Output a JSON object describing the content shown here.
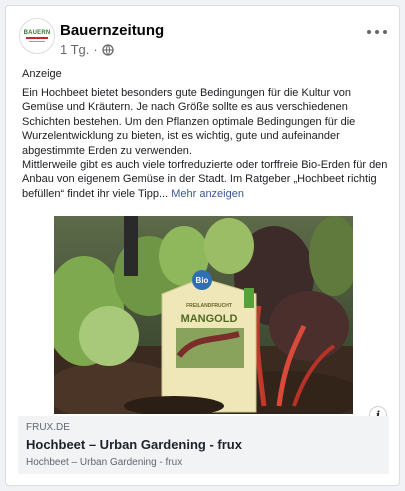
{
  "post": {
    "page_name": "Bauernzeitung",
    "avatar_logo_text": "BAUERN",
    "time": "1 Tg.",
    "separator": "·",
    "visibility_icon": "globe-icon",
    "more_icon": "more-horizontal-icon",
    "ad_label": "Anzeige",
    "paragraph_1": "Ein Hochbeet bietet besonders gute Bedingungen für die Kultur von Gemüse und Kräutern. Je nach Größe sollte es aus verschiedenen Schichten bestehen. Um den Pflanzen optimale Bedingungen für die Wurzelentwicklung zu bieten, ist es wichtig, gute und aufeinander abgestimmte Erden zu verwenden.",
    "paragraph_2": "Mittlerweile gibt es auch viele torfreduzierte oder torffreie Bio-Erden für den Anbau von eigenem Gemüse in der Stadt. Im Ratgeber „Hochbeet richtig befüllen“ findet ihr viele Tipp...",
    "see_more": "Mehr anzeigen"
  },
  "image": {
    "tag_badge": "Bio",
    "tag_small_text": "FREILANDFRUCHT",
    "tag_title": "MANGOLD",
    "info_icon": "info-icon",
    "info_symbol": "i"
  },
  "link": {
    "domain": "FRUX.DE",
    "title": "Hochbeet – Urban Gardening - frux",
    "description": "Hochbeet – Urban Gardening - frux"
  }
}
